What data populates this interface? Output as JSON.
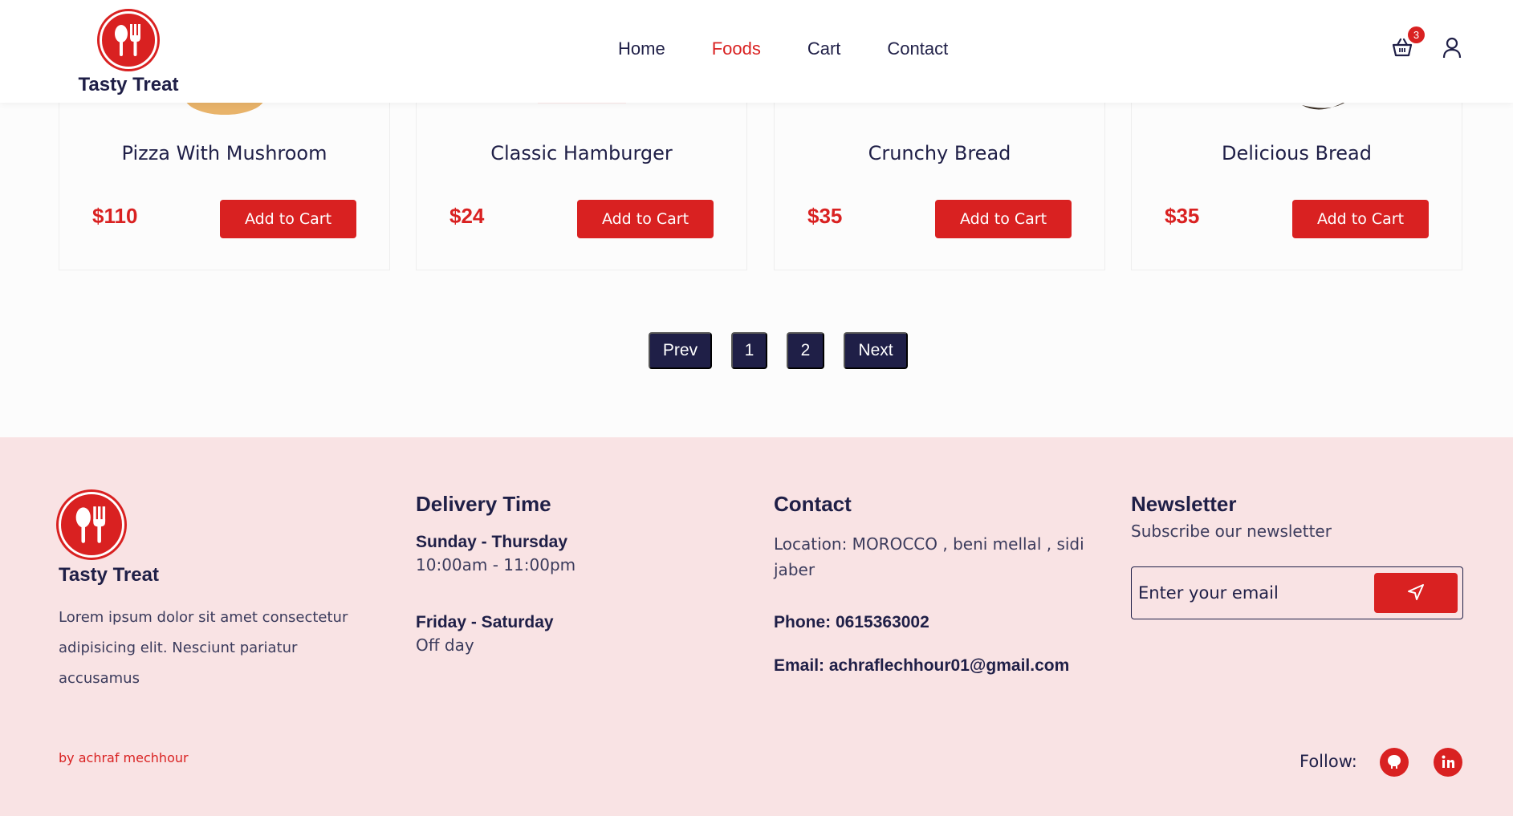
{
  "header": {
    "brand": "Tasty Treat",
    "nav": [
      "Home",
      "Foods",
      "Cart",
      "Contact"
    ],
    "active_nav": "Foods",
    "cart_count": "3"
  },
  "products": [
    {
      "name": "Pizza With Mushroom",
      "price": "$110",
      "button": "Add to Cart"
    },
    {
      "name": "Classic Hamburger",
      "price": "$24",
      "button": "Add to Cart"
    },
    {
      "name": "Crunchy Bread",
      "price": "$35",
      "button": "Add to Cart"
    },
    {
      "name": "Delicious Bread",
      "price": "$35",
      "button": "Add to Cart"
    }
  ],
  "pagination": {
    "prev": "Prev",
    "pages": [
      "1",
      "2"
    ],
    "next": "Next"
  },
  "footer": {
    "brand": "Tasty Treat",
    "description": "Lorem ipsum dolor sit amet consectetur adipisicing elit. Nesciunt pariatur accusamus",
    "delivery": {
      "title": "Delivery Time",
      "slot1_days": "Sunday - Thursday",
      "slot1_hours": "10:00am - 11:00pm",
      "slot2_days": "Friday - Saturday",
      "slot2_hours": "Off day"
    },
    "contact": {
      "title": "Contact",
      "location": "Location: MOROCCO , beni mellal , sidi jaber",
      "phone": "Phone: 0615363002",
      "email": "Email: achraflechhour01@gmail.com"
    },
    "newsletter": {
      "title": "Newsletter",
      "subtitle": "Subscribe our newsletter",
      "placeholder": "Enter your email"
    },
    "byline": "by achraf mechhour",
    "follow_label": "Follow:",
    "social_icons": [
      "github-icon",
      "linkedin-icon"
    ]
  },
  "colors": {
    "accent": "#d92121",
    "navy": "#1f1f47",
    "footer_bg": "#f9e3e4"
  }
}
